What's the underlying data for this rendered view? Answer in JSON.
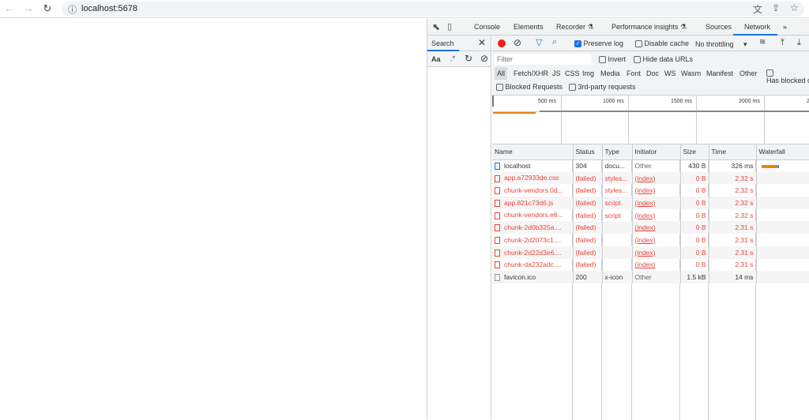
{
  "browser": {
    "url": "localhost:5678",
    "icons": [
      "back-icon",
      "forward-icon",
      "reload-icon",
      "info-icon",
      "translate-icon",
      "share-icon",
      "star-icon"
    ]
  },
  "devtools": {
    "tabs": [
      "Console",
      "Elements",
      "Recorder",
      "Performance insights",
      "Sources",
      "Network"
    ],
    "active_tab": "Network",
    "search": {
      "label": "Search",
      "aa": "Aa",
      "regex": ".*"
    },
    "toolbar": {
      "preserve_log": "Preserve log",
      "preserve_log_checked": true,
      "disable_cache": "Disable cache",
      "throttling": "No throttling"
    },
    "filter": {
      "placeholder": "Filter",
      "invert": "Invert",
      "hide_data_urls": "Hide data URLs"
    },
    "types": [
      "All",
      "Fetch/XHR",
      "JS",
      "CSS",
      "Img",
      "Media",
      "Font",
      "Doc",
      "WS",
      "Wasm",
      "Manifest",
      "Other"
    ],
    "has_blocked": "Has blocked cookies",
    "blocked_requests": "Blocked Requests",
    "third_party": "3rd-party requests",
    "timeline_ticks": [
      "500 ms",
      "1000 ms",
      "1500 ms",
      "2000 ms",
      "2"
    ],
    "columns": [
      "Name",
      "Status",
      "Type",
      "Initiator",
      "Size",
      "Time",
      "Waterfall"
    ],
    "rows": [
      {
        "name": "localhost",
        "status": "304",
        "type": "docu...",
        "initiator": "Other",
        "size": "430 B",
        "time": "326 ms",
        "failed": false,
        "icon": "doc"
      },
      {
        "name": "app.a72933de.css",
        "status": "(failed)",
        "type": "styles...",
        "initiator": "(index)",
        "size": "0 B",
        "time": "2.32 s",
        "failed": true,
        "icon": "css"
      },
      {
        "name": "chunk-vendors.0d...",
        "status": "(failed)",
        "type": "styles...",
        "initiator": "(index)",
        "size": "0 B",
        "time": "2.32 s",
        "failed": true,
        "icon": "css"
      },
      {
        "name": "app.821c73d6.js",
        "status": "(failed)",
        "type": "script",
        "initiator": "(index)",
        "size": "0 B",
        "time": "2.32 s",
        "failed": true,
        "icon": "js"
      },
      {
        "name": "chunk-vendors.e6...",
        "status": "(failed)",
        "type": "script",
        "initiator": "(index)",
        "size": "0 B",
        "time": "2.32 s",
        "failed": true,
        "icon": "js"
      },
      {
        "name": "chunk-2d0b325a....",
        "status": "(failed)",
        "type": "",
        "initiator": "(index)",
        "size": "0 B",
        "time": "2.31 s",
        "failed": true,
        "icon": "other"
      },
      {
        "name": "chunk-2d2073c1....",
        "status": "(failed)",
        "type": "",
        "initiator": "(index)",
        "size": "0 B",
        "time": "2.31 s",
        "failed": true,
        "icon": "other"
      },
      {
        "name": "chunk-2d22d3e6....",
        "status": "(failed)",
        "type": "",
        "initiator": "(index)",
        "size": "0 B",
        "time": "2.31 s",
        "failed": true,
        "icon": "other"
      },
      {
        "name": "chunk-da232adc....",
        "status": "(failed)",
        "type": "",
        "initiator": "(index)",
        "size": "0 B",
        "time": "2.31 s",
        "failed": true,
        "icon": "other"
      },
      {
        "name": "favicon.ico",
        "status": "200",
        "type": "x-icon",
        "initiator": "Other",
        "size": "1.5 kB",
        "time": "14 ms",
        "failed": false,
        "icon": "plain"
      }
    ]
  }
}
